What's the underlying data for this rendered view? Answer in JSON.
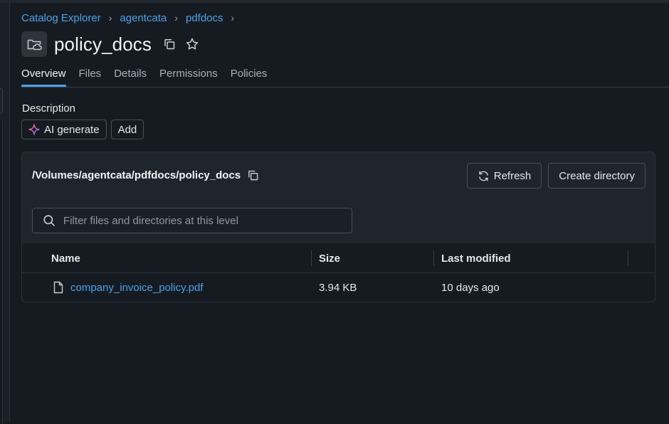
{
  "breadcrumb": [
    "Catalog Explorer",
    "agentcata",
    "pdfdocs"
  ],
  "breadcrumb_separator": "›",
  "title": "policy_docs",
  "tabs": [
    {
      "label": "Overview",
      "active": true
    },
    {
      "label": "Files",
      "active": false
    },
    {
      "label": "Details",
      "active": false
    },
    {
      "label": "Permissions",
      "active": false
    },
    {
      "label": "Policies",
      "active": false
    }
  ],
  "description": {
    "label": "Description",
    "ai_generate_label": "AI generate",
    "add_label": "Add"
  },
  "volume_panel": {
    "path": "/Volumes/agentcata/pdfdocs/policy_docs",
    "refresh_label": "Refresh",
    "create_directory_label": "Create directory",
    "filter_placeholder": "Filter files and directories at this level"
  },
  "table": {
    "columns": {
      "name": "Name",
      "size": "Size",
      "last_modified": "Last modified"
    },
    "rows": [
      {
        "name": "company_invoice_policy.pdf",
        "size": "3.94 KB",
        "last_modified": "10 days ago"
      }
    ]
  },
  "icons": {
    "volume": "folder-cloud-icon",
    "copy": "copy-icon",
    "favorite": "star-icon",
    "ai": "sparkle-icon",
    "refresh": "refresh-icon",
    "search": "search-icon",
    "file": "file-icon"
  },
  "colors": {
    "accent": "#4ea1e8",
    "background": "#161b22",
    "panel": "#1f252d"
  }
}
